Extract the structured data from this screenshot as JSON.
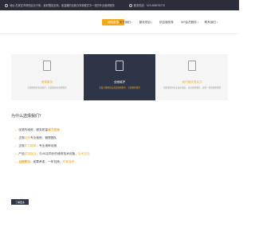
{
  "topbar": {
    "address": "地址:石家庄市桥西区长兴街，最好国如全街，最温暖的全新办事新模式中一流的专业维修服务",
    "phone": "服务热线：029-88876270"
  },
  "nav": {
    "items": [
      {
        "label": "网站首页",
        "active": true,
        "caret": false
      },
      {
        "label": "关于我们",
        "active": false,
        "caret": true
      },
      {
        "label": "服务项目",
        "active": false,
        "caret": true
      },
      {
        "label": "供应服务条",
        "active": false,
        "caret": false
      },
      {
        "label": "VIP会员服务",
        "active": false,
        "caret": true
      },
      {
        "label": "联系我们",
        "active": false,
        "caret": true
      }
    ]
  },
  "cards": [
    {
      "title": "常规服务",
      "desc": "全面维修的专业服务，全面维护的维修服务",
      "dark": false
    },
    {
      "title": "全面维护",
      "desc": "全面对维修的完善及维修服务，全面维修服务",
      "dark": true
    },
    {
      "title": "我们团队的实力",
      "desc": "全面维修的专业技术团队，专业维修服务，提供一流的维修服务",
      "dark": false
    }
  ],
  "section": {
    "title": "为什么选择我们？",
    "items": [
      {
        "prefix": "优质的维修，服务质量",
        "highlight": "维力支持",
        "bold": true,
        "suffix": ""
      },
      {
        "prefix": "正规",
        "highlight": "经验",
        "bold": false,
        "suffix": "专业维修，管理团队"
      },
      {
        "prefix": "正规",
        "highlight": "实力雄厚",
        "bold": false,
        "suffix": "，专业维修设施"
      },
      {
        "prefix": "产品",
        "highlight": "质量保证",
        "bold": false,
        "suffix": "，与4S店同步的维修技术设备，",
        "highlight2": "技术支持"
      },
      {
        "prefix": "",
        "highlight": "全程售后",
        "bold": true,
        "suffix": "，如果承诺，一年包换，",
        "highlight2": "终身保修"
      }
    ]
  },
  "cta": {
    "label": "了解更多"
  }
}
